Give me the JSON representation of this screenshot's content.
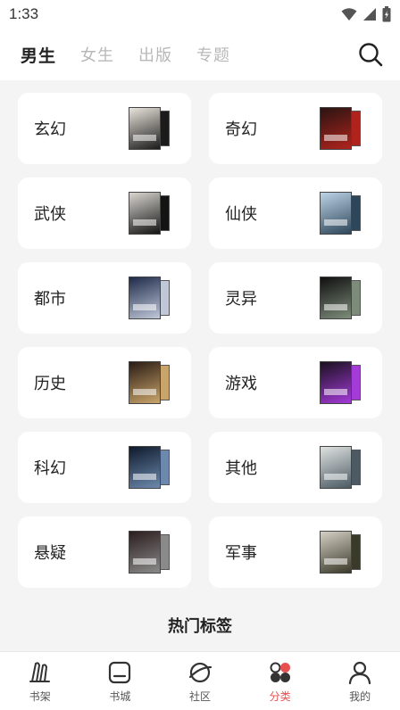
{
  "status_bar": {
    "time": "1:33"
  },
  "top_tabs": [
    {
      "label": "男生",
      "active": true
    },
    {
      "label": "女生",
      "active": false
    },
    {
      "label": "出版",
      "active": false
    },
    {
      "label": "专题",
      "active": false
    }
  ],
  "categories": [
    {
      "label": "玄幻",
      "cover_colors": [
        "#e9e4dc",
        "#1b1b1b"
      ]
    },
    {
      "label": "奇幻",
      "cover_colors": [
        "#2a1412",
        "#b0231d"
      ]
    },
    {
      "label": "武侠",
      "cover_colors": [
        "#d9d6d0",
        "#141414"
      ]
    },
    {
      "label": "仙侠",
      "cover_colors": [
        "#bcd4e6",
        "#2e4659"
      ]
    },
    {
      "label": "都市",
      "cover_colors": [
        "#1e2a4a",
        "#c0c8d8"
      ]
    },
    {
      "label": "灵异",
      "cover_colors": [
        "#101010",
        "#7d8c7a"
      ]
    },
    {
      "label": "历史",
      "cover_colors": [
        "#2a1c14",
        "#caa56b"
      ]
    },
    {
      "label": "游戏",
      "cover_colors": [
        "#1a1020",
        "#a43ad8"
      ]
    },
    {
      "label": "科幻",
      "cover_colors": [
        "#0f1a2c",
        "#6c89ad"
      ]
    },
    {
      "label": "其他",
      "cover_colors": [
        "#dfe2e0",
        "#4b5a63"
      ]
    },
    {
      "label": "悬疑",
      "cover_colors": [
        "#2c1e1e",
        "#8a8a8a"
      ]
    },
    {
      "label": "军事",
      "cover_colors": [
        "#d4cfc4",
        "#3a3a2a"
      ]
    }
  ],
  "hot_tags_title": "热门标签",
  "bottom_nav": [
    {
      "label": "书架",
      "icon": "bookshelf-icon",
      "active": false
    },
    {
      "label": "书城",
      "icon": "bookstore-icon",
      "active": false
    },
    {
      "label": "社区",
      "icon": "community-icon",
      "active": false
    },
    {
      "label": "分类",
      "icon": "category-icon",
      "active": true
    },
    {
      "label": "我的",
      "icon": "profile-icon",
      "active": false
    }
  ],
  "colors": {
    "accent": "#e8504f",
    "background": "#f4f4f4",
    "card": "#ffffff"
  }
}
